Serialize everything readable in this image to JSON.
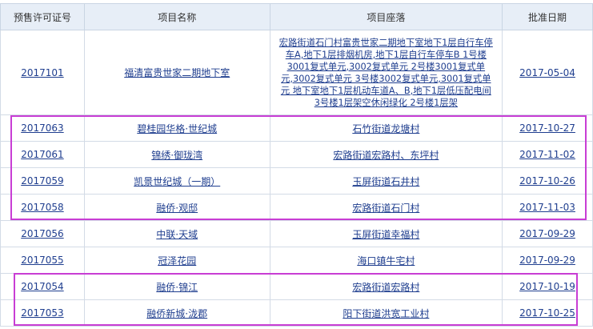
{
  "table": {
    "headers": [
      "预售许可证号",
      "项目名称",
      "项目座落",
      "批准日期"
    ],
    "rows": [
      {
        "id": "2017101",
        "name": "福清富贵世家二期地下室",
        "location": "宏路街道石门村富贵世家二期地下室地下1层自行车停车A,地下1层排烟机房,地下1层自行车停车B 1号楼3001复式单元,3002复式单元 2号楼3001复式单元,3002复式单元 3号楼3002复式单元,3001复式单元 地下室地下1层机动车道A、B,地下1层低压配电间 3号楼1层架空休闲绿化 2号楼1层架",
        "date": "2017-05-04"
      },
      {
        "id": "2017063",
        "name": "碧桂园华格·世纪城",
        "location": "石竹街道龙塘村",
        "date": "2017-10-27"
      },
      {
        "id": "2017061",
        "name": "锦绣·御珑湾",
        "location": "宏路街道宏路村、东坪村",
        "date": "2017-11-02"
      },
      {
        "id": "2017059",
        "name": "凯景世纪城（一期）",
        "location": "玉屏街道石井村",
        "date": "2017-10-26"
      },
      {
        "id": "2017058",
        "name": "融侨·观邸",
        "location": "宏路街道石门村",
        "date": "2017-11-03"
      },
      {
        "id": "2017056",
        "name": "中联·天域",
        "location": "玉屏街道幸福村",
        "date": "2017-09-29"
      },
      {
        "id": "2017055",
        "name": "冠泽花园",
        "location": "海口镇牛宅村",
        "date": "2017-09-29"
      },
      {
        "id": "2017054",
        "name": "融侨·锦江",
        "location": "宏路街道宏路村",
        "date": "2017-10-19"
      },
      {
        "id": "2017053",
        "name": "融侨新城·泷郡",
        "location": "阳下街道洪宽工业村",
        "date": "2017-10-25"
      }
    ]
  },
  "colors": {
    "header_bg": "#e7eef7",
    "link": "#1f3e8f",
    "highlight": "#c83dd4"
  }
}
